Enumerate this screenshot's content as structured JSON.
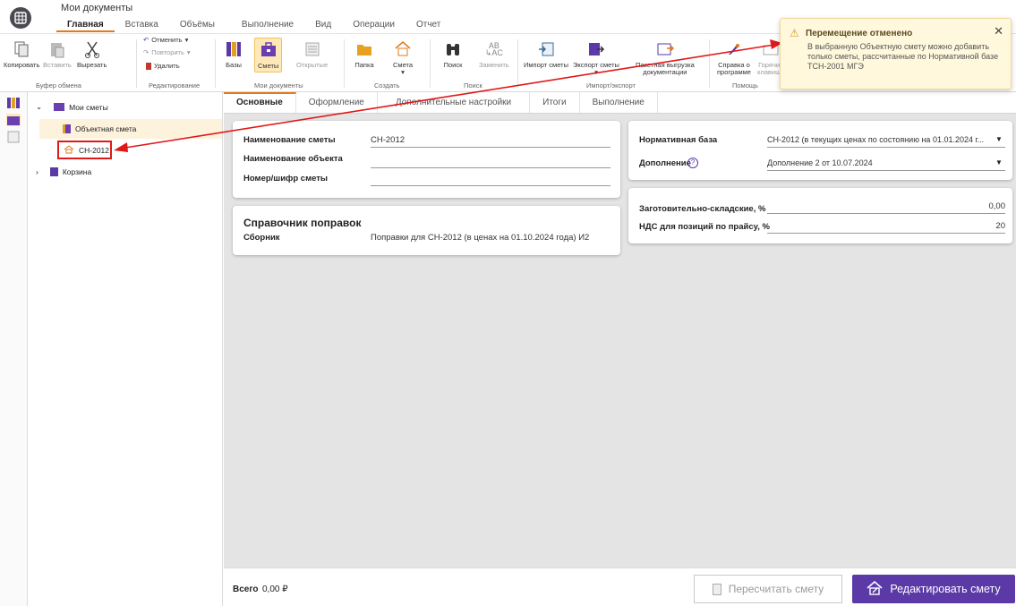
{
  "window": {
    "title": "Мои документы"
  },
  "menu_tabs": [
    "Главная",
    "Вставка",
    "Объёмы",
    "Выполнение",
    "Вид",
    "Операции",
    "Отчет"
  ],
  "ribbon": {
    "copy": "Копировать",
    "paste": "Вставить",
    "cut": "Вырезать",
    "undo": "Отменить",
    "redo": "Повторить",
    "delete": "Удалить",
    "bases": "Базы",
    "estimates": "Сметы",
    "opened": "Открытые",
    "folder": "Папка",
    "estimate": "Смета",
    "search": "Поиск",
    "replace": "Заменить",
    "import_estimate": "Импорт сметы",
    "export_estimate": "Экспорт сметы",
    "batch_export_1": "Пакетная выгрузка",
    "batch_export_2": "документации",
    "help_1": "Справка о",
    "help_2": "программе",
    "hotkeys_1": "Горячие",
    "hotkeys_2": "клавиши",
    "groups": {
      "clipboard": "Буфер обмена",
      "editing": "Редактирование",
      "my_docs": "Мои документы",
      "create": "Создать",
      "search": "Поиск",
      "import_export": "Импорт/экспорт",
      "help": "Помощь"
    }
  },
  "tree": {
    "root": "Мои сметы",
    "object_estimate": "Объектная смета",
    "item": "СН-2012",
    "trash": "Корзина"
  },
  "content_tabs": [
    "Основные",
    "Оформление",
    "Дополнительные настройки",
    "Итоги",
    "Выполнение"
  ],
  "main_card": {
    "name_label": "Наименование сметы",
    "name_value": "СН-2012",
    "object_label": "Наименование объекта",
    "number_label": "Номер/шифр сметы"
  },
  "corrections": {
    "title": "Справочник поправок",
    "collection_label": "Сборник",
    "collection_value": "Поправки для СН-2012 (в ценах на 01.10.2024 года) И2"
  },
  "norm_card": {
    "base_label": "Нормативная база",
    "base_value": "СН-2012 (в текущих ценах по состоянию на 01.01.2024 г...",
    "addition_label": "Дополнение",
    "addition_value": "Дополнение 2 от 10.07.2024"
  },
  "rates_card": {
    "storage_label": "Заготовительно-складские, %",
    "storage_value": "0,00",
    "vat_label": "НДС для позиций по прайсу, %",
    "vat_value": "20"
  },
  "bottom": {
    "total_label": "Всего",
    "total_value": "0,00 ₽",
    "recalc": "Пересчитать смету",
    "edit": "Редактировать смету"
  },
  "toast": {
    "title": "Перемещение отменено",
    "message": "В выбранную Объектную смету можно добавить только сметы, рассчитанные по Нормативной базе ТСН-2001 МГЭ"
  },
  "colors": {
    "accent": "#e07a1a",
    "primary_button": "#5b3aa7",
    "annotation": "#e01818",
    "toast_bg": "#fff8dc"
  }
}
